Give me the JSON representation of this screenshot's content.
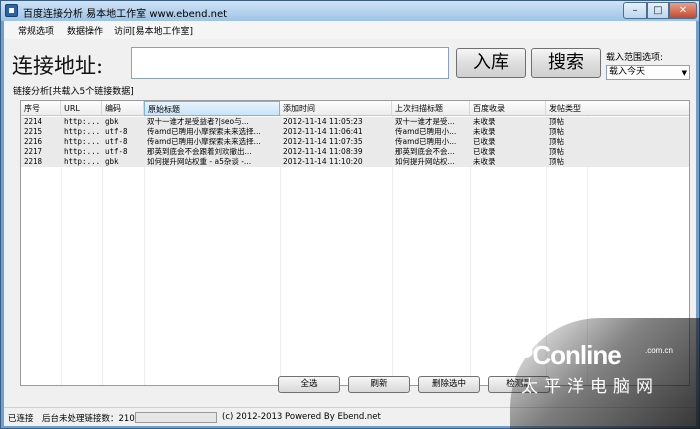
{
  "window": {
    "title": "百度连接分析 易本地工作室 www.ebend.net",
    "min_glyph": "–",
    "max_glyph": "□",
    "close_glyph": "✕"
  },
  "menu": [
    "常规选项",
    "数据操作",
    "访问[易本地工作室]"
  ],
  "address": {
    "label": "连接地址:",
    "value": "",
    "store_button": "入库",
    "search_button": "搜索"
  },
  "range": {
    "label": "载入范围选项:",
    "selected": "载入今天"
  },
  "summary": "链接分析[共载入5个链接数据]",
  "table": {
    "columns": [
      "序号",
      "URL",
      "编码",
      "原始标题",
      "添加时间",
      "上次扫描标题",
      "百度收录",
      "发帖类型"
    ],
    "rows": [
      [
        "2214",
        "http:...",
        "gbk",
        "双十一谁才是受益者?|seo与...",
        "2012-11-14 11:05:23",
        "双十一谁才是受...",
        "未收录",
        "顶帖"
      ],
      [
        "2215",
        "http:...",
        "utf-8",
        "传amd已聘用小摩探索未来选择...",
        "2012-11-14 11:06:41",
        "传amd已聘用小...",
        "未收录",
        "顶帖"
      ],
      [
        "2216",
        "http:...",
        "utf-8",
        "传amd已聘用小摩探索未来选择...",
        "2012-11-14 11:07:35",
        "传amd已聘用小...",
        "已收录",
        "顶帖"
      ],
      [
        "2217",
        "http:...",
        "utf-8",
        "那英到底会不会跟着刘欢撤出...",
        "2012-11-14 11:08:39",
        "那英到底会不会...",
        "已收录",
        "顶帖"
      ],
      [
        "2218",
        "http:...",
        "gbk",
        "如何提升网站权重 - a5杂谈 -...",
        "2012-11-14 11:10:20",
        "如何提升网站权...",
        "未收录",
        "顶帖"
      ]
    ]
  },
  "actions": [
    "全选",
    "刷新",
    "删除选中",
    "检测最"
  ],
  "status": {
    "connected": "已连接",
    "pending": "后台未处理链接数：210",
    "copyright": "(c) 2012-2013 Powered By Ebend.net"
  },
  "watermark": {
    "brand": "PConline",
    "domain": ".com.cn",
    "cn": "太平洋电脑网"
  }
}
